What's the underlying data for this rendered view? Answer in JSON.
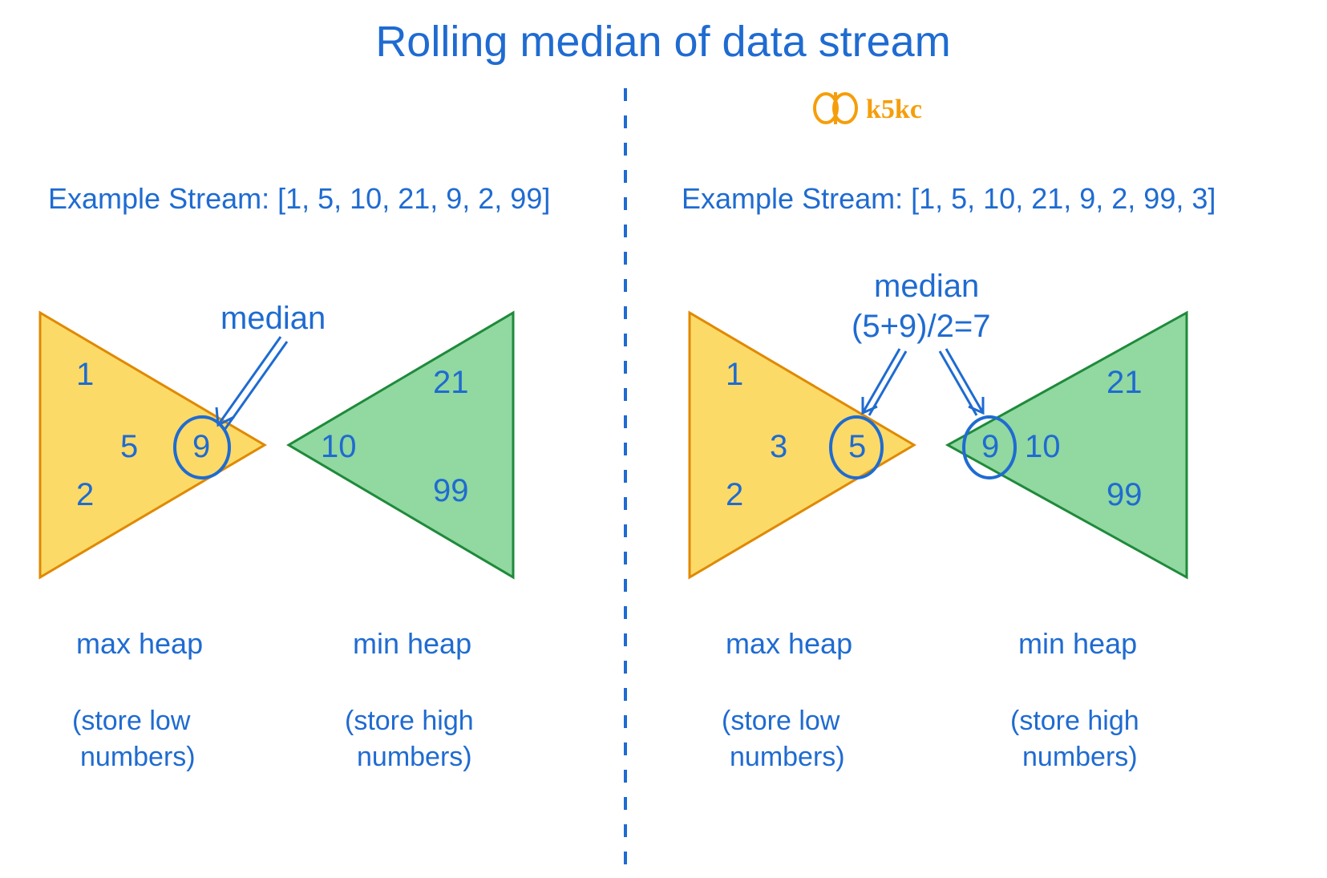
{
  "title": "Rolling median of data stream",
  "brand": "k5kc",
  "left": {
    "stream_label": "Example Stream: [1, 5, 10, 21, 9, 2, 99]",
    "median_label": "median",
    "max_heap": {
      "values": {
        "a": "1",
        "b": "5",
        "c": "2",
        "top": "9"
      },
      "label": "max heap",
      "desc1": "(store low",
      "desc2": "numbers)"
    },
    "min_heap": {
      "values": {
        "top": "10",
        "a": "21",
        "b": "99"
      },
      "label": "min heap",
      "desc1": "(store high",
      "desc2": "numbers)"
    }
  },
  "right": {
    "stream_label": "Example Stream: [1, 5, 10, 21, 9, 2, 99, 3]",
    "median_label": "median",
    "median_calc": "(5+9)/2=7",
    "max_heap": {
      "values": {
        "a": "1",
        "b": "3",
        "c": "2",
        "top": "5"
      },
      "label": "max heap",
      "desc1": "(store low",
      "desc2": "numbers)"
    },
    "min_heap": {
      "values": {
        "top": "9",
        "mid": "10",
        "a": "21",
        "b": "99"
      },
      "label": "min heap",
      "desc1": "(store high",
      "desc2": "numbers)"
    }
  }
}
